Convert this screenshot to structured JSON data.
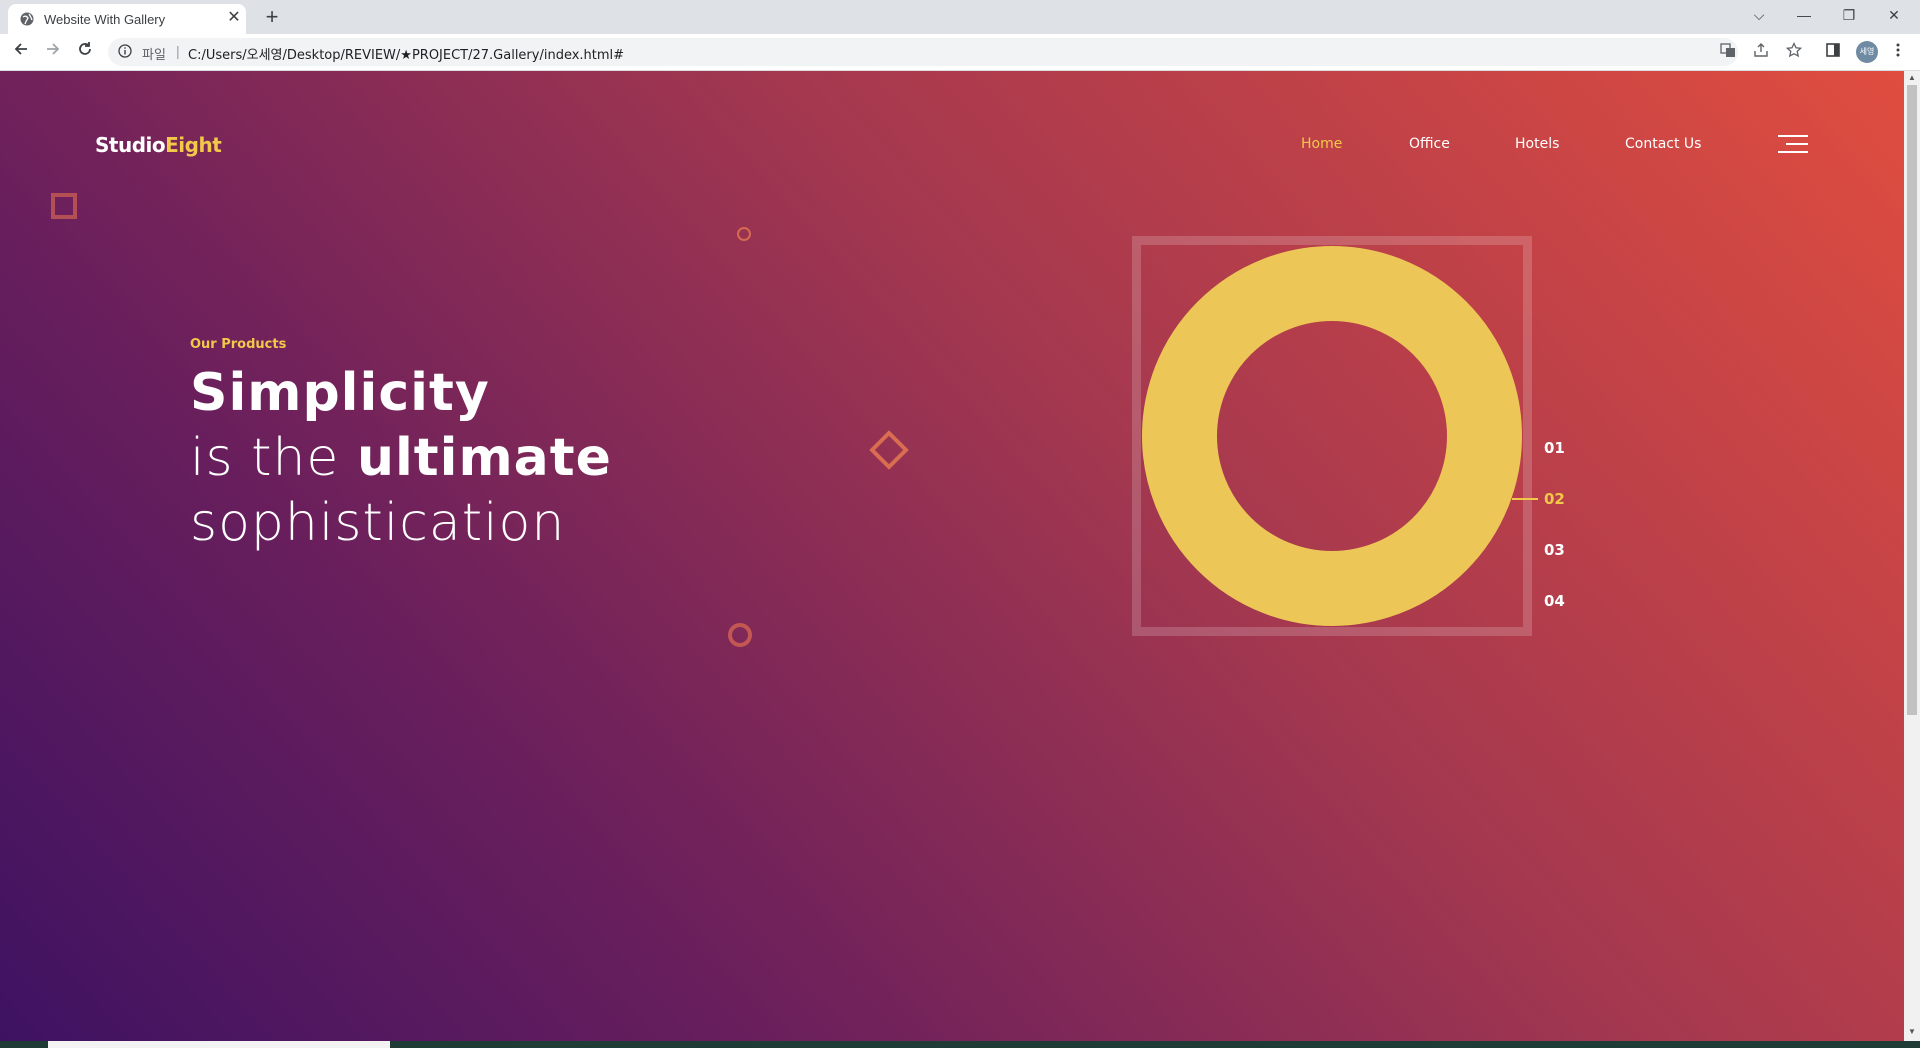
{
  "browser": {
    "tab_title": "Website With Gallery",
    "tab_close": "✕",
    "new_tab": "+",
    "scheme_label": "파일",
    "url": "C:/Users/오세영/Desktop/REVIEW/★PROJECT/27.Gallery/index.html#",
    "profile_label": "세영",
    "window_controls": [
      "⌵",
      "—",
      "❐",
      "✕"
    ]
  },
  "header": {
    "logo_part1": "Studio",
    "logo_part2": "Eight",
    "nav": [
      "Home",
      "Office",
      "Hotels",
      "Contact Us"
    ],
    "active_nav": "Home"
  },
  "hero": {
    "subtitle": "Our Products",
    "line1": "Simplicity",
    "line2_light": "is the ",
    "line2_bold": "ultimate",
    "line3": "sophistication"
  },
  "slider": {
    "numbers": [
      "01",
      "02",
      "03",
      "04"
    ],
    "active": "02"
  },
  "colors": {
    "accent": "#f2c84b",
    "ring": "#ecc657",
    "gradient_start": "#3e1262",
    "gradient_end": "#e04d3f"
  },
  "icons": [
    "globe-icon",
    "back-arrow-icon",
    "forward-arrow-icon",
    "reload-icon",
    "info-icon",
    "translate-icon",
    "share-icon",
    "star-icon",
    "sidebar-icon",
    "menu-icon",
    "hamburger-icon"
  ]
}
